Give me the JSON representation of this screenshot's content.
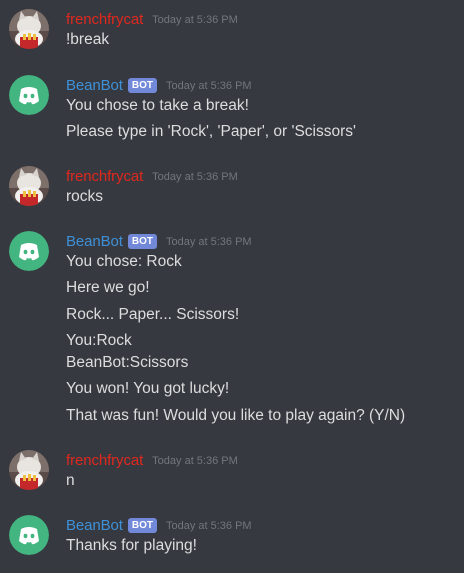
{
  "colors": {
    "background": "#36393f",
    "user_name": "#e0281e",
    "bot_name": "#3e90d8",
    "bot_tag": "#7289da",
    "discord_green": "#43b581",
    "timestamp": "#72767d",
    "message_text": "#dcddde"
  },
  "messages": [
    {
      "author": "frenchfrycat",
      "is_bot": false,
      "avatar_icon": "cat-avatar-icon",
      "timestamp": "Today at 5:36 PM",
      "lines": [
        "!break"
      ]
    },
    {
      "author": "BeanBot",
      "is_bot": true,
      "bot_tag": "BOT",
      "avatar_icon": "discord-logo-icon",
      "timestamp": "Today at 5:36 PM",
      "lines": [
        "You chose to take a break!",
        "Please type in 'Rock', 'Paper', or 'Scissors'"
      ]
    },
    {
      "author": "frenchfrycat",
      "is_bot": false,
      "avatar_icon": "cat-avatar-icon",
      "timestamp": "Today at 5:36 PM",
      "lines": [
        "rocks"
      ]
    },
    {
      "author": "BeanBot",
      "is_bot": true,
      "bot_tag": "BOT",
      "avatar_icon": "discord-logo-icon",
      "timestamp": "Today at 5:36 PM",
      "lines": [
        "You chose: Rock",
        "Here we go!",
        "Rock... Paper... Scissors!",
        "You:Rock",
        "BeanBot:Scissors",
        "You won! You got lucky!",
        "That was fun! Would you like to play again? (Y/N)"
      ]
    },
    {
      "author": "frenchfrycat",
      "is_bot": false,
      "avatar_icon": "cat-avatar-icon",
      "timestamp": "Today at 5:36 PM",
      "lines": [
        "n"
      ]
    },
    {
      "author": "BeanBot",
      "is_bot": true,
      "bot_tag": "BOT",
      "avatar_icon": "discord-logo-icon",
      "timestamp": "Today at 5:36 PM",
      "lines": [
        "Thanks for playing!"
      ]
    }
  ]
}
